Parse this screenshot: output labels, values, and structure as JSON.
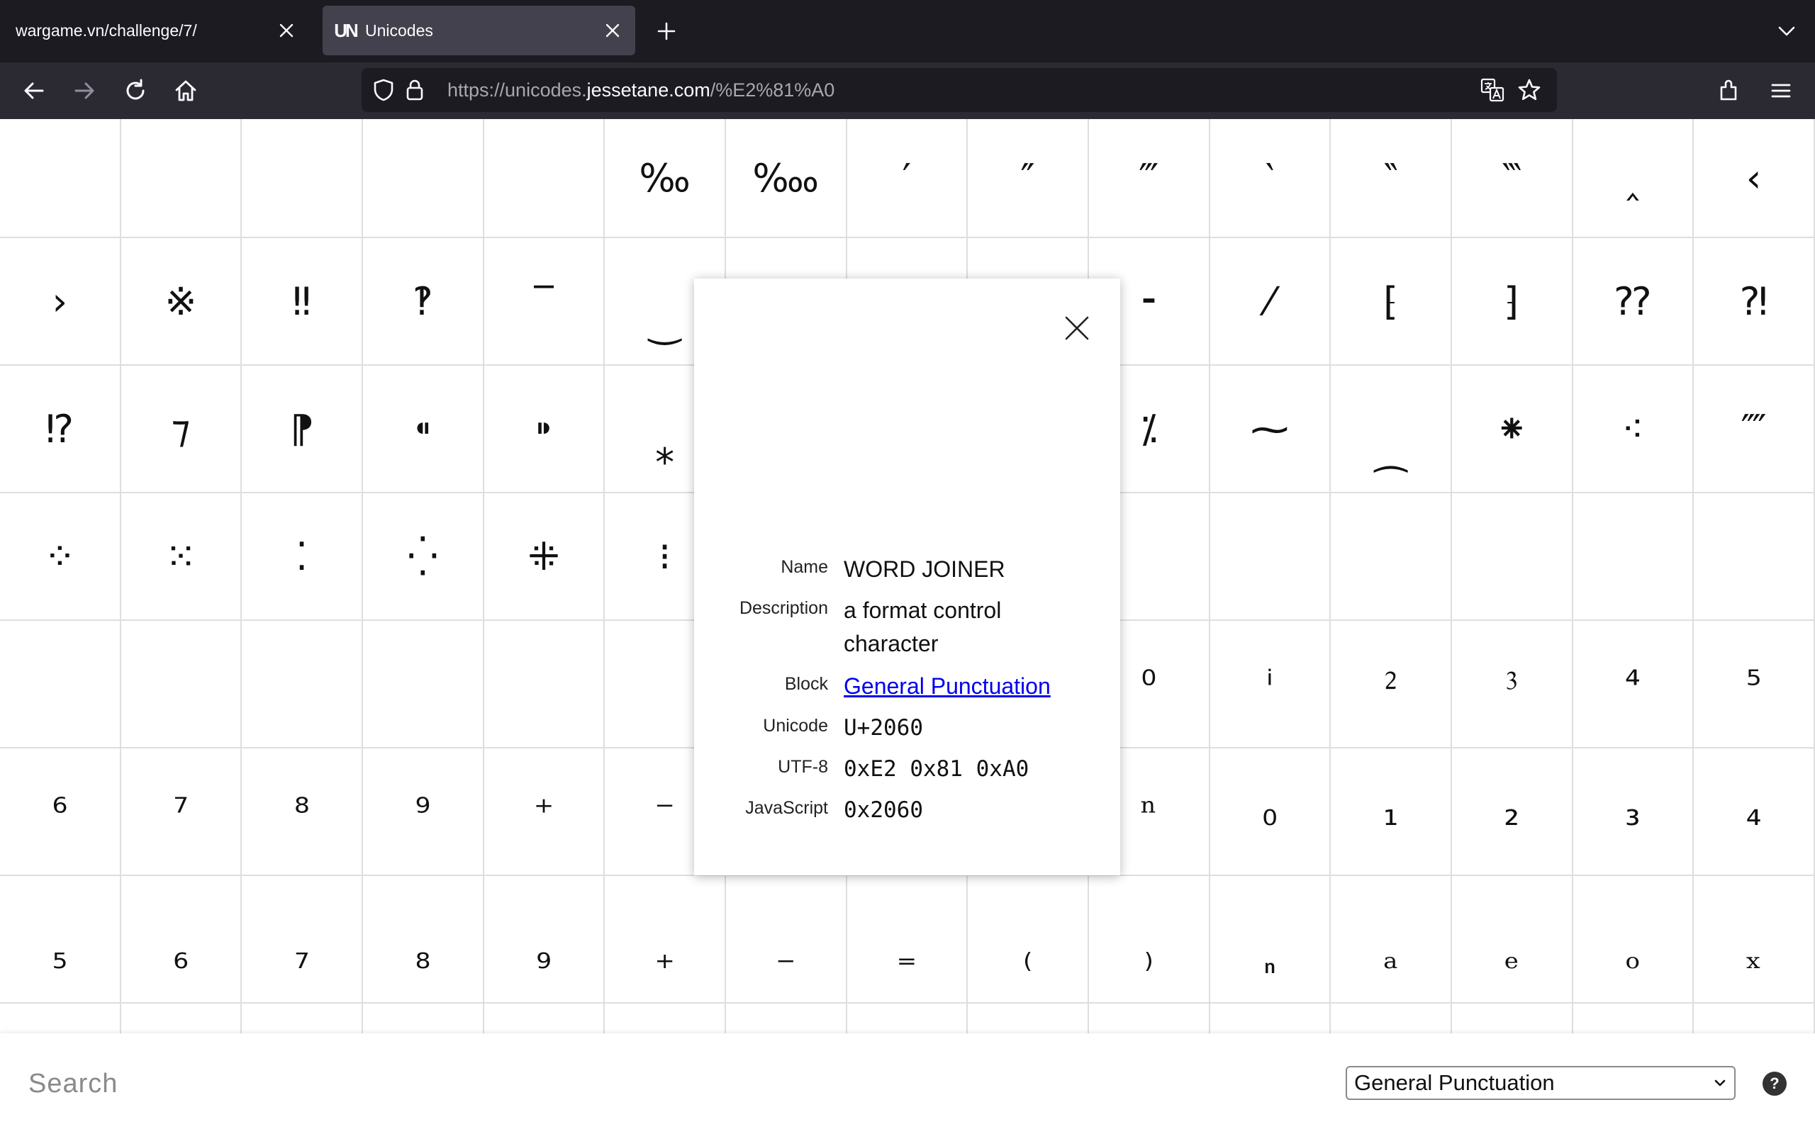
{
  "browser": {
    "tabs": [
      {
        "title": "wargame.vn/challenge/7/",
        "active": false
      },
      {
        "title": "Unicodes",
        "active": true,
        "favicon_text": "UN"
      }
    ],
    "url": {
      "prefix": "https://unicodes.",
      "host": "jessetane.com",
      "path": "/%E2%81%A0"
    }
  },
  "grid": {
    "rows": [
      [
        "",
        "",
        "",
        "",
        "",
        "‰",
        "‱",
        "′",
        "″",
        "‴",
        "‵",
        "‶",
        "‷",
        "‸",
        "‹"
      ],
      [
        "›",
        "※",
        "‼",
        "‽",
        "‾",
        "‿",
        "⁀",
        "⁁",
        "⁂",
        "⁃",
        "⁄",
        "⁅",
        "⁆",
        "⁇",
        "⁈"
      ],
      [
        "⁉",
        "⁊",
        "⁋",
        "⁌",
        "⁍",
        "⁎",
        "⁏",
        "⁐",
        "⁑",
        "⁒",
        "⁓",
        "⁔",
        "⁕",
        "⁖",
        "⁗"
      ],
      [
        "⁘",
        "⁙",
        "⁚",
        "⁛",
        "⁜",
        "⁝",
        "⁞",
        "",
        "",
        "",
        "",
        "",
        "",
        "",
        ""
      ],
      [
        "",
        "",
        "",
        "",
        "",
        "",
        "",
        "",
        "",
        "⁰",
        "ⁱ",
        "⁲",
        "⁳",
        "⁴",
        "⁵"
      ],
      [
        "⁶",
        "⁷",
        "⁸",
        "⁹",
        "⁺",
        "⁻",
        "⁼",
        "⁽",
        "⁾",
        "ⁿ",
        "₀",
        "₁",
        "₂",
        "₃",
        "₄"
      ],
      [
        "₅",
        "₆",
        "₇",
        "₈",
        "₉",
        "₊",
        "₋",
        "₌",
        "₍",
        "₎",
        "₏",
        "ₐ",
        "ₑ",
        "ₒ",
        "ₓ"
      ],
      [
        "",
        "",
        "",
        "",
        "",
        "",
        "",
        "",
        "",
        "",
        "",
        "",
        "",
        "",
        ""
      ]
    ]
  },
  "detail": {
    "name_label": "Name",
    "name": "WORD JOINER",
    "description_label": "Description",
    "description": "a format control character",
    "block_label": "Block",
    "block": "General Punctuation",
    "unicode_label": "Unicode",
    "unicode": "U+2060",
    "utf8_label": "UTF-8",
    "utf8": "0xE2 0x81 0xA0",
    "javascript_label": "JavaScript",
    "javascript": "0x2060"
  },
  "footer": {
    "search_placeholder": "Search",
    "search_value": "",
    "block_selected": "General Punctuation",
    "help_label": "?"
  }
}
